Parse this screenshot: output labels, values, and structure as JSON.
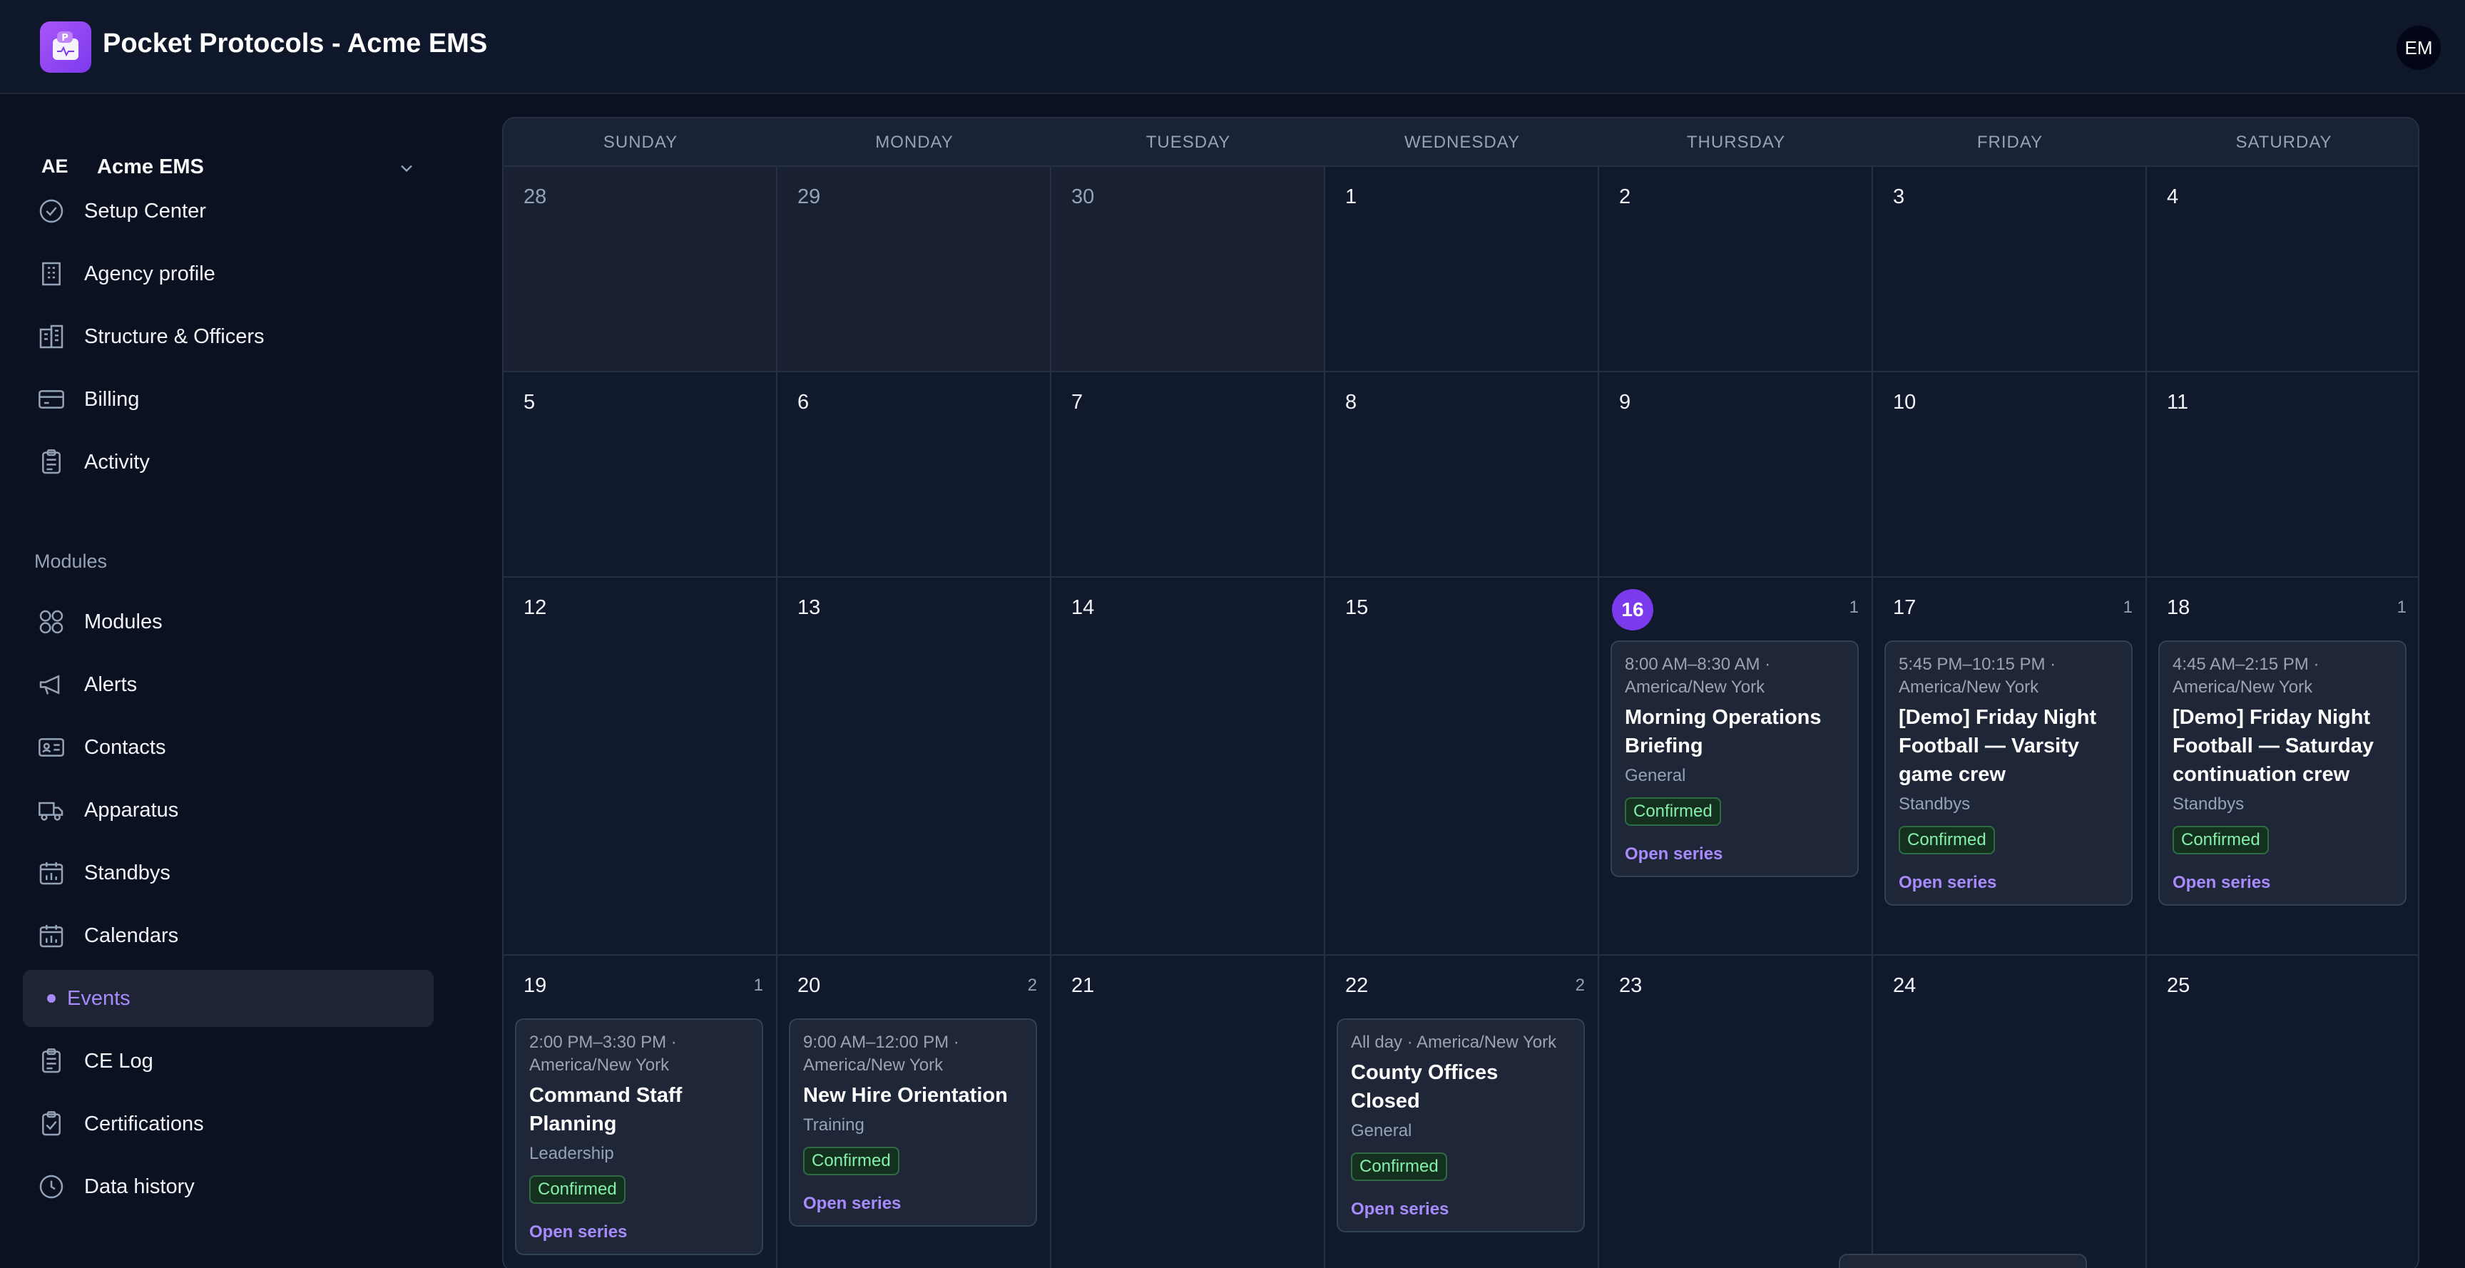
{
  "header": {
    "app_title": "Pocket Protocols - Acme EMS",
    "user_initials": "EM"
  },
  "sidebar": {
    "org": {
      "initials": "AE",
      "name": "Acme EMS"
    },
    "top_items": [
      {
        "label": "Setup Center",
        "icon": "check-circle-icon"
      },
      {
        "label": "Agency profile",
        "icon": "building-icon"
      },
      {
        "label": "Structure & Officers",
        "icon": "buildings-icon"
      },
      {
        "label": "Billing",
        "icon": "credit-card-icon"
      },
      {
        "label": "Activity",
        "icon": "clipboard-icon"
      }
    ],
    "modules_heading": "Modules",
    "module_items": [
      {
        "label": "Modules",
        "icon": "grid-icon"
      },
      {
        "label": "Alerts",
        "icon": "megaphone-icon"
      },
      {
        "label": "Contacts",
        "icon": "id-card-icon"
      },
      {
        "label": "Apparatus",
        "icon": "truck-icon"
      },
      {
        "label": "Standbys",
        "icon": "calendar-chart-icon"
      },
      {
        "label": "Calendars",
        "icon": "calendar-chart-icon"
      },
      {
        "label": "Events",
        "icon": "dot-icon",
        "active": true
      },
      {
        "label": "CE Log",
        "icon": "clipboard-icon"
      },
      {
        "label": "Certifications",
        "icon": "clipboard-check-icon"
      },
      {
        "label": "Data history",
        "icon": "clock-icon"
      }
    ]
  },
  "calendar": {
    "weekdays": [
      "SUNDAY",
      "MONDAY",
      "TUESDAY",
      "WEDNESDAY",
      "THURSDAY",
      "FRIDAY",
      "SATURDAY"
    ],
    "weeks": [
      {
        "days": [
          {
            "num": "28",
            "other": true
          },
          {
            "num": "29",
            "other": true
          },
          {
            "num": "30",
            "other": true
          },
          {
            "num": "1"
          },
          {
            "num": "2"
          },
          {
            "num": "3"
          },
          {
            "num": "4"
          }
        ]
      },
      {
        "days": [
          {
            "num": "5"
          },
          {
            "num": "6"
          },
          {
            "num": "7"
          },
          {
            "num": "8"
          },
          {
            "num": "9"
          },
          {
            "num": "10"
          },
          {
            "num": "11"
          }
        ]
      },
      {
        "days": [
          {
            "num": "12"
          },
          {
            "num": "13"
          },
          {
            "num": "14"
          },
          {
            "num": "15"
          },
          {
            "num": "16",
            "today": true,
            "count": "1"
          },
          {
            "num": "17",
            "count": "1"
          },
          {
            "num": "18",
            "count": "1"
          }
        ]
      },
      {
        "days": [
          {
            "num": "19",
            "count": "1"
          },
          {
            "num": "20",
            "count": "2"
          },
          {
            "num": "21"
          },
          {
            "num": "22",
            "count": "2"
          },
          {
            "num": "23"
          },
          {
            "num": "24"
          },
          {
            "num": "25"
          }
        ]
      }
    ],
    "events": {
      "thu16": {
        "time": "8:00 AM–8:30 AM · America/New York",
        "title": "Morning Operations Briefing",
        "category": "General",
        "status": "Confirmed",
        "link": "Open series"
      },
      "fri17": {
        "time": "5:45 PM–10:15 PM · America/New York",
        "title": "[Demo] Friday Night Football — Varsity game crew",
        "category": "Standbys",
        "status": "Confirmed",
        "link": "Open series"
      },
      "sat18": {
        "time": "4:45 AM–2:15 PM · America/New York",
        "title": "[Demo] Friday Night Football — Saturday continuation crew",
        "category": "Standbys",
        "status": "Confirmed",
        "link": "Open series"
      },
      "sun19": {
        "time": "2:00 PM–3:30 PM · America/New York",
        "title": "Command Staff Planning",
        "category": "Leadership",
        "status": "Confirmed",
        "link": "Open series"
      },
      "mon20": {
        "time": "9:00 AM–12:00 PM · America/New York",
        "title": "New Hire Orientation",
        "category": "Training",
        "status": "Confirmed",
        "link": "Open series"
      },
      "wed22": {
        "time": "All day · America/New York",
        "title": "County Offices Closed",
        "category": "General",
        "status": "Confirmed",
        "link": "Open series"
      }
    }
  }
}
